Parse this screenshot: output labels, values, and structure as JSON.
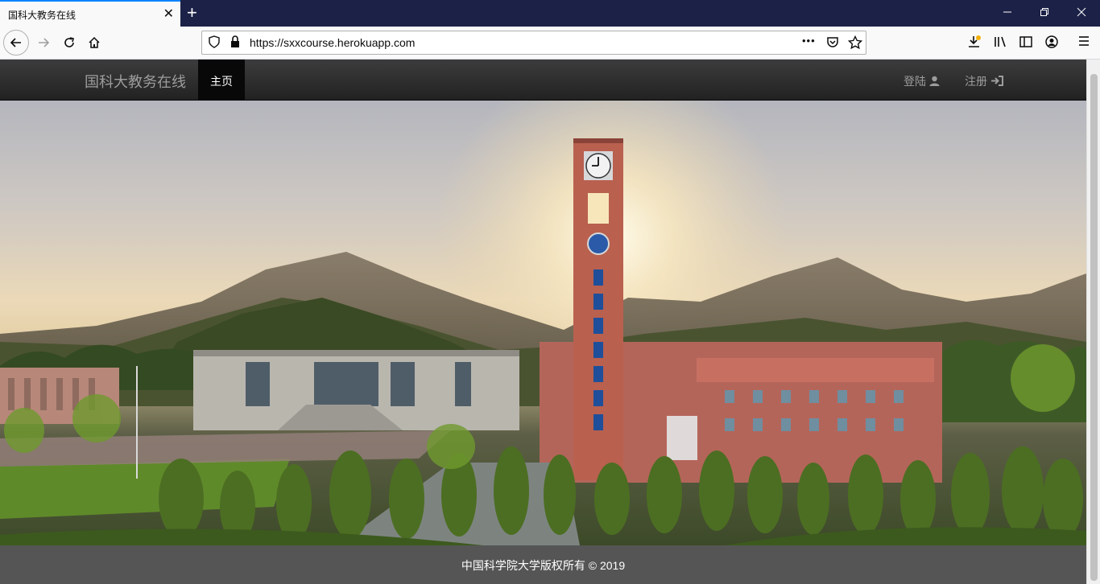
{
  "browser": {
    "tab_title": "国科大教务在线",
    "tab_close": "✕",
    "new_tab": "+",
    "url": "https://sxxcourse.herokuapp.com",
    "url_more": "•••"
  },
  "site": {
    "brand": "国科大教务在线",
    "nav": {
      "home": "主页",
      "login": "登陆",
      "register": "注册"
    }
  },
  "hero": {
    "image_subject": "campus clock tower at sunset"
  },
  "footer": {
    "copyright": "中国科学院大学版权所有 © 2019"
  },
  "colors": {
    "tab_accent": "#0a84ff",
    "titlebar": "#1c2147",
    "navbar": "#222222",
    "footer": "#555555"
  }
}
